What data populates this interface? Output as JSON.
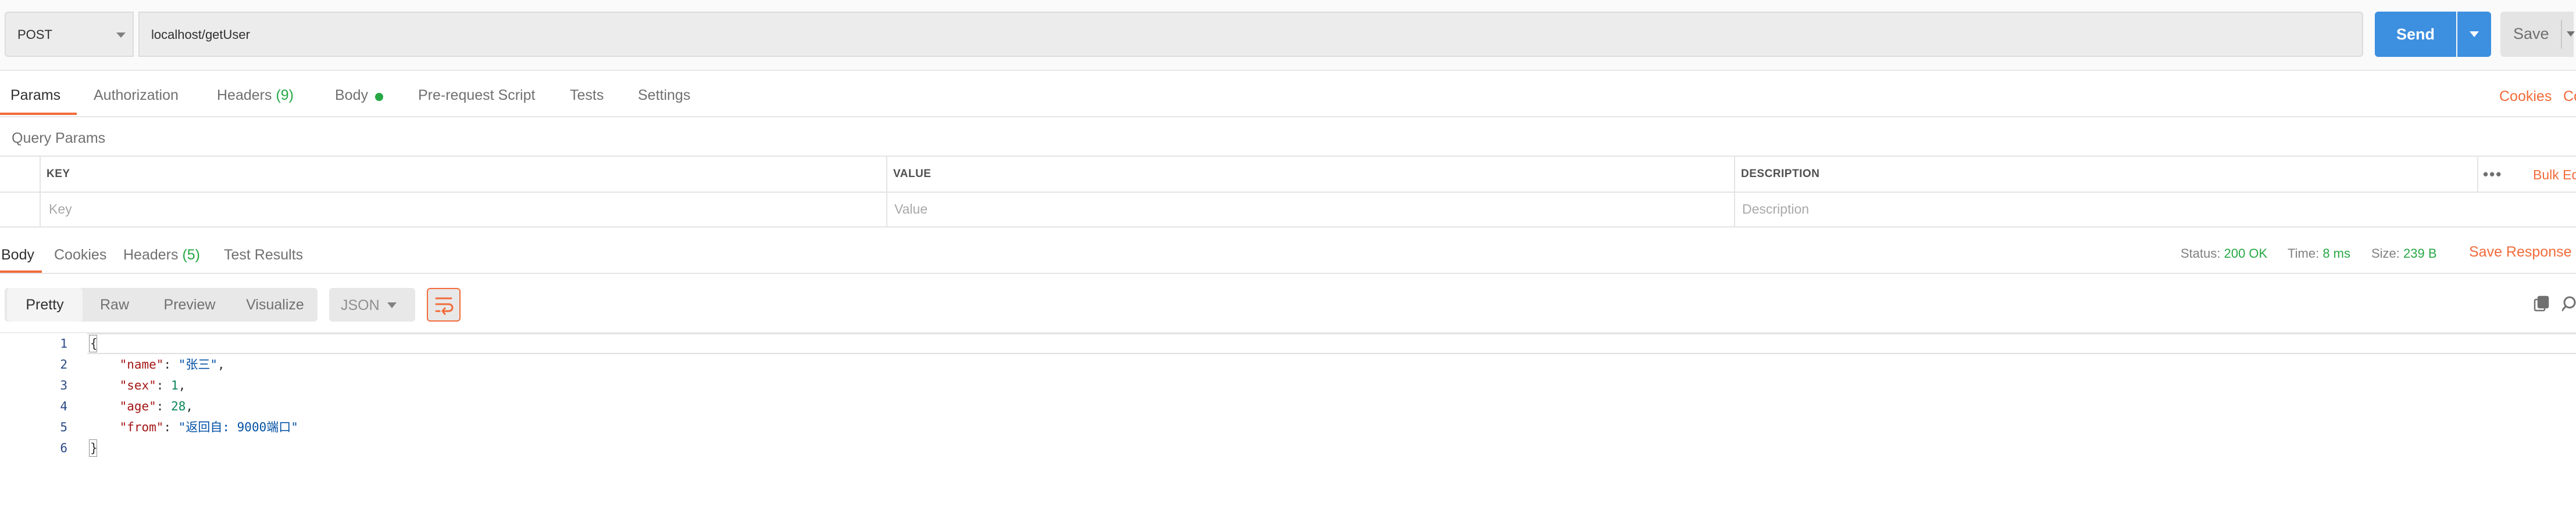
{
  "request": {
    "method": "POST",
    "url": "localhost/getUser",
    "send_label": "Send",
    "save_label": "Save"
  },
  "request_tabs": [
    {
      "label": "Params",
      "active": true
    },
    {
      "label": "Authorization"
    },
    {
      "label": "Headers",
      "count": "(9)"
    },
    {
      "label": "Body",
      "indicator": "green-dot"
    },
    {
      "label": "Pre-request Script"
    },
    {
      "label": "Tests"
    },
    {
      "label": "Settings"
    }
  ],
  "right_links": {
    "cookies": "Cookies",
    "code": "Code"
  },
  "query_params": {
    "title": "Query Params",
    "columns": [
      "KEY",
      "VALUE",
      "DESCRIPTION"
    ],
    "placeholders": [
      "Key",
      "Value",
      "Description"
    ],
    "bulk_edit": "Bulk Edit"
  },
  "response": {
    "tabs": [
      {
        "label": "Body",
        "active": true
      },
      {
        "label": "Cookies"
      },
      {
        "label": "Headers",
        "count": "(5)"
      },
      {
        "label": "Test Results"
      }
    ],
    "status_label": "Status:",
    "status_value": "200 OK",
    "time_label": "Time:",
    "time_value": "8 ms",
    "size_label": "Size:",
    "size_value": "239 B",
    "save_response": "Save Response",
    "view_modes": [
      "Pretty",
      "Raw",
      "Preview",
      "Visualize"
    ],
    "active_view_mode": "Pretty",
    "format": "JSON",
    "icons": {
      "wrap": "wrap-lines-icon",
      "copy": "copy-icon",
      "search": "search-icon"
    }
  },
  "code": {
    "line_numbers": [
      "1",
      "2",
      "3",
      "4",
      "5",
      "6"
    ],
    "open_brace": "{",
    "close_brace": "}",
    "fields": [
      {
        "key": "\"name\"",
        "value": "\"张三\"",
        "type": "string",
        "comma": ","
      },
      {
        "key": "\"sex\"",
        "value": "1",
        "type": "number",
        "comma": ","
      },
      {
        "key": "\"age\"",
        "value": "28",
        "type": "number",
        "comma": ","
      },
      {
        "key": "\"from\"",
        "value": "\"返回自: 9000端口\"",
        "type": "string",
        "comma": ""
      }
    ]
  },
  "colors": {
    "accent": "#f26b3a",
    "send_button": "#3d8fe0",
    "success": "#27a844"
  }
}
